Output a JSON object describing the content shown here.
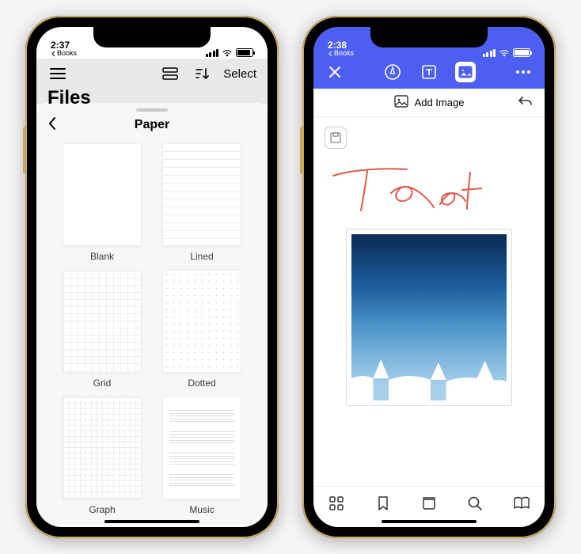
{
  "left": {
    "status": {
      "time": "2:37",
      "back_app": "Books"
    },
    "files": {
      "title": "Files",
      "select_label": "Select"
    },
    "sheet": {
      "title": "Paper",
      "items": [
        {
          "label": "Blank"
        },
        {
          "label": "Lined"
        },
        {
          "label": "Grid"
        },
        {
          "label": "Dotted"
        },
        {
          "label": "Graph"
        },
        {
          "label": "Music"
        }
      ]
    }
  },
  "right": {
    "status": {
      "time": "2:38",
      "back_app": "Books"
    },
    "toolbar": {
      "close_icon": "close-icon",
      "pen_icon": "pen-icon",
      "text_icon": "text-icon",
      "image_icon": "image-icon",
      "more_icon": "more-icon"
    },
    "add_image_label": "Add Image",
    "handwriting_text": "Test",
    "bottom_tabs": {
      "grid": "grid-icon",
      "bookmark": "bookmark-icon",
      "cards": "cards-icon",
      "search": "search-icon",
      "book": "book-icon"
    }
  }
}
